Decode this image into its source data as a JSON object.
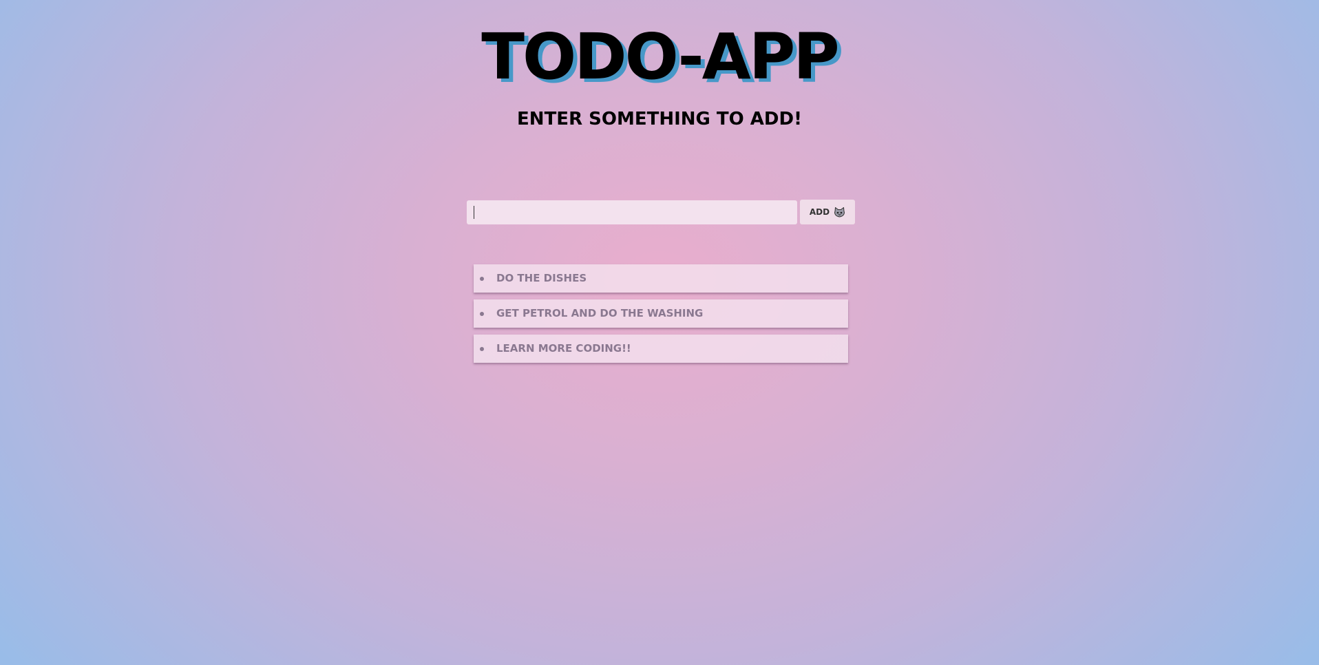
{
  "header": {
    "title": "TODO-APP",
    "subtitle": "ENTER SOMETHING TO ADD!"
  },
  "form": {
    "input_value": "",
    "add_label": "ADD",
    "add_icon": "cat-face-icon"
  },
  "todos": [
    {
      "text": "DO THE DISHES"
    },
    {
      "text": "GET PETROL AND DO THE WASHING"
    },
    {
      "text": "LEARN MORE CODING!!"
    }
  ],
  "colors": {
    "title_shadow": "#4798c8",
    "background_center": "#e9aecd",
    "background_edge": "#99bce8",
    "item_text": "#8a7890"
  }
}
